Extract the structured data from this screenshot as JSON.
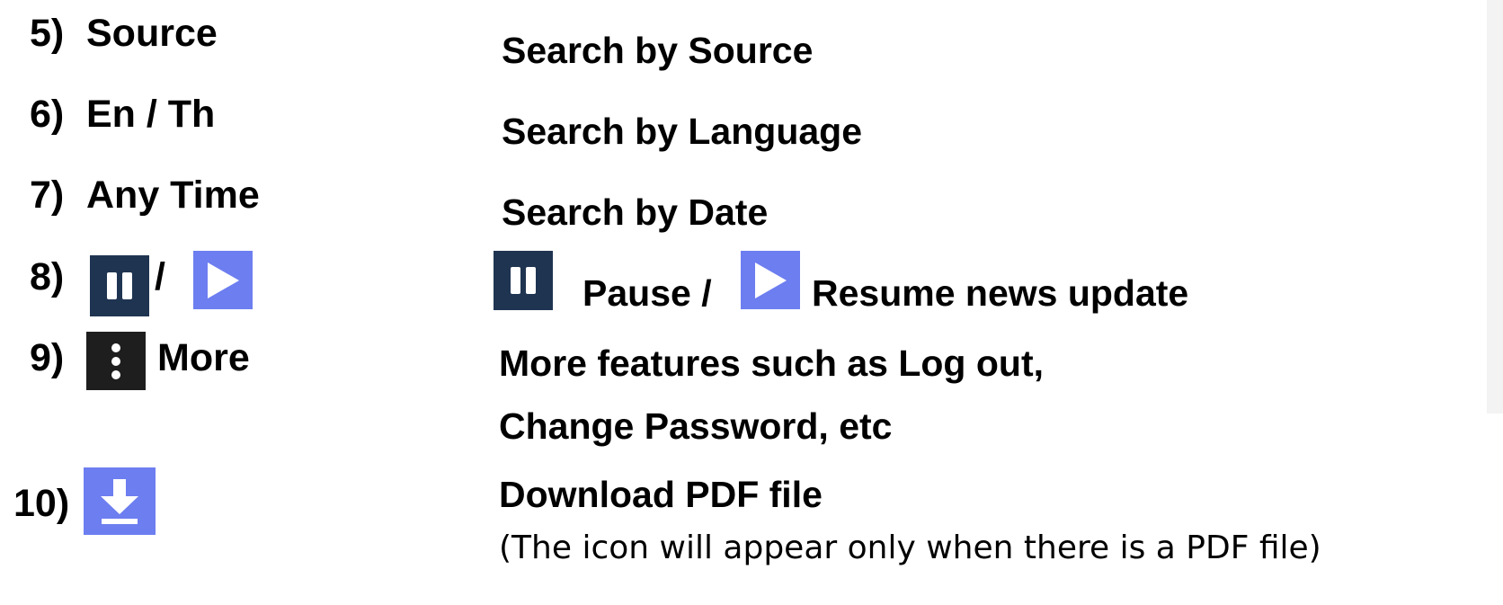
{
  "rows": [
    {
      "number": "5)",
      "label": "Source",
      "description": "Search by Source"
    },
    {
      "number": "6)",
      "label": "En / Th",
      "description": "Search by Language"
    },
    {
      "number": "7)",
      "label": "Any Time",
      "description": "Search by Date"
    },
    {
      "number": "8)",
      "separator": "/",
      "description_pause": "Pause /",
      "description_resume": "Resume news update"
    },
    {
      "number": "9)",
      "label": "More",
      "description_line1": "More features such as Log out,",
      "description_line2": "Change Password, etc"
    },
    {
      "number": "10)",
      "description": "Download PDF file",
      "note": "(The icon will appear only when there is a PDF file)"
    }
  ],
  "icons": {
    "pause": "pause-icon",
    "play": "play-icon",
    "more": "more-vertical-icon",
    "download": "download-icon"
  },
  "colors": {
    "pause_bg": "#1f3451",
    "play_bg": "#6d7ef0",
    "more_bg": "#1e1e1e",
    "download_bg": "#6d7ef0"
  }
}
